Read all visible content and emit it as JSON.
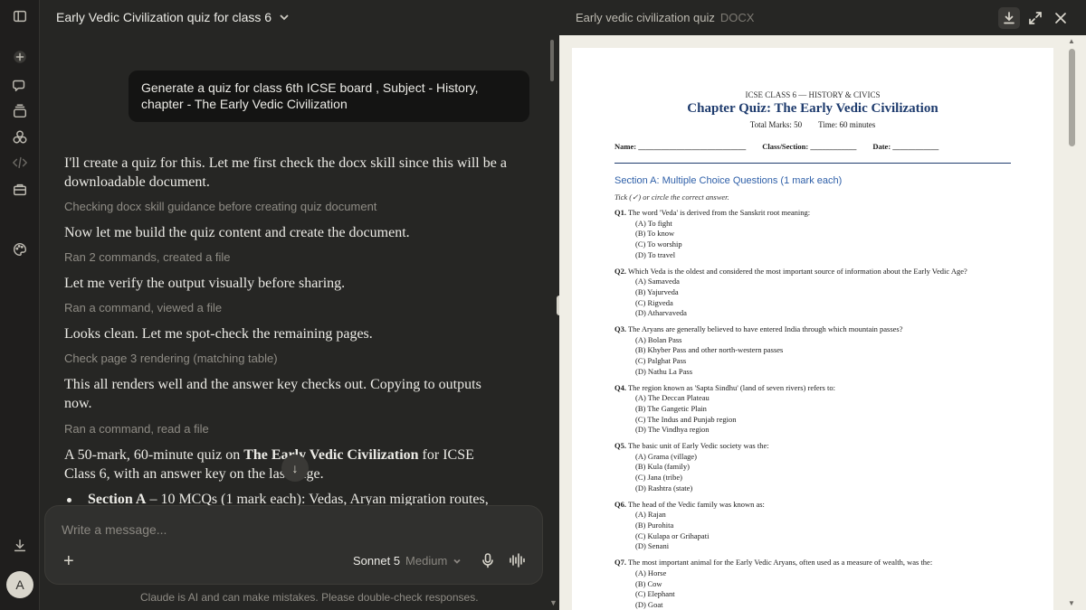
{
  "chat": {
    "title": "Early Vedic Civilization quiz for class 6",
    "user_message": "Generate a quiz for class 6th ICSE board , Subject - History, chapter - The Early Vedic Civilization",
    "m1": "I'll create a quiz for this. Let me first check the docx skill since this will be a downloadable document.",
    "s1": "Checking docx skill guidance before creating quiz document",
    "m2": "Now let me build the quiz content and create the document.",
    "s2": "Ran 2 commands, created a file",
    "m3": "Let me verify the output visually before sharing.",
    "s3": "Ran a command, viewed a file",
    "m4": "Looks clean. Let me spot-check the remaining pages.",
    "s4": "Check page 3 rendering (matching table)",
    "m5": "This all renders well and the answer key checks out. Copying to outputs now.",
    "s5": "Ran a command, read a file",
    "m6_pre": "A 50-mark, 60-minute quiz on ",
    "m6_bold": "The Early Vedic Civilization",
    "m6_post": " for ICSE Class 6, with an answer key on the last page.",
    "bullet_bold": "Section A",
    "bullet_rest": " – 10 MCQs (1 mark each): Vedas, Aryan migration routes,",
    "composer_placeholder": "Write a message...",
    "model_name": "Sonnet 5",
    "model_effort": "Medium",
    "disclaimer": "Claude is AI and can make mistakes. Please double-check responses.",
    "avatar_letter": "A"
  },
  "preview": {
    "title": "Early vedic civilization quiz",
    "file_type": "DOCX"
  },
  "doc": {
    "class_line": "ICSE CLASS 6 — HISTORY & CIVICS",
    "title": "Chapter Quiz: The Early Vedic Civilization",
    "total_marks": "Total Marks: 50",
    "time": "Time: 60 minutes",
    "name_field": "Name: ____________________________",
    "class_field": "Class/Section: ____________",
    "date_field": "Date: ____________",
    "section_a": "Section A: Multiple Choice Questions (1 mark each)",
    "instruction": "Tick (✓) or circle the correct answer.",
    "questions": [
      {
        "num": "Q1.",
        "text": "The word 'Veda' is derived from the Sanskrit root meaning:",
        "options": [
          "(A) To fight",
          "(B) To know",
          "(C) To worship",
          "(D) To travel"
        ]
      },
      {
        "num": "Q2.",
        "text": "Which Veda is the oldest and considered the most important source of information about the Early Vedic Age?",
        "options": [
          "(A) Samaveda",
          "(B) Yajurveda",
          "(C) Rigveda",
          "(D) Atharvaveda"
        ]
      },
      {
        "num": "Q3.",
        "text": "The Aryans are generally believed to have entered India through which mountain passes?",
        "options": [
          "(A) Bolan Pass",
          "(B) Khyber Pass and other north-western passes",
          "(C) Palghat Pass",
          "(D) Nathu La Pass"
        ]
      },
      {
        "num": "Q4.",
        "text": "The region known as 'Sapta Sindhu' (land of seven rivers) refers to:",
        "options": [
          "(A) The Deccan Plateau",
          "(B) The Gangetic Plain",
          "(C) The Indus and Punjab region",
          "(D) The Vindhya region"
        ]
      },
      {
        "num": "Q5.",
        "text": "The basic unit of Early Vedic society was the:",
        "options": [
          "(A) Grama (village)",
          "(B) Kula (family)",
          "(C) Jana (tribe)",
          "(D) Rashtra (state)"
        ]
      },
      {
        "num": "Q6.",
        "text": "The head of the Vedic family was known as:",
        "options": [
          "(A) Rajan",
          "(B) Purohita",
          "(C) Kulapa or Grihapati",
          "(D) Senani"
        ]
      },
      {
        "num": "Q7.",
        "text": "The most important animal for the Early Vedic Aryans, often used as a measure of wealth, was the:",
        "options": [
          "(A) Horse",
          "(B) Cow",
          "(C) Elephant",
          "(D) Goat"
        ]
      }
    ]
  }
}
